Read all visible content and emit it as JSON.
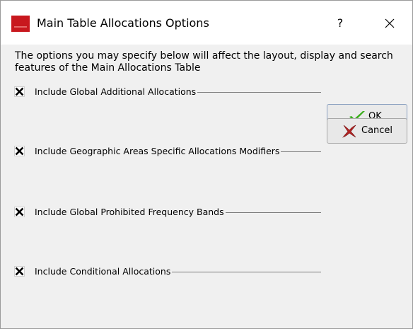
{
  "window": {
    "title": "Main Table Allocations Options",
    "help_label": "?",
    "close_label": "✕",
    "brand_color": "#c8181e"
  },
  "intro_text_line1": "The options you may specify below will affect the layout, display and search",
  "intro_text_line2": "features of the Main Allocations Table",
  "options": [
    {
      "label": "Include Global Additional Allocations",
      "checked": true
    },
    {
      "label": "Include Geographic Areas Specific Allocations Modifiers",
      "checked": true
    },
    {
      "label": "Include Global Prohibited Frequency Bands",
      "checked": true
    },
    {
      "label": "Include Conditional Allocations",
      "checked": true
    }
  ],
  "buttons": {
    "ok_label": "OK",
    "ok_icon": "green-checkmark-icon",
    "cancel_label": "Cancel",
    "cancel_icon": "red-x-icon"
  }
}
